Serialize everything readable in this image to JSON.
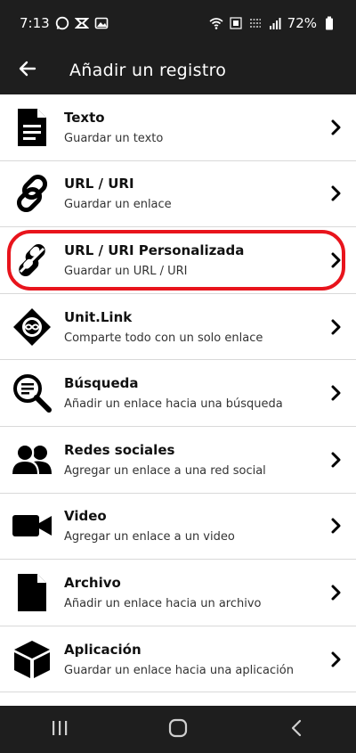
{
  "status_bar": {
    "time": "7:13",
    "battery_percent": "72%"
  },
  "app_bar": {
    "title": "Añadir un registro"
  },
  "items": [
    {
      "title": "Texto",
      "subtitle": "Guardar un texto",
      "icon": "document-icon"
    },
    {
      "title": "URL / URI",
      "subtitle": "Guardar un enlace",
      "icon": "link-icon"
    },
    {
      "title": "URL / URI Personalizada",
      "subtitle": "Guardar un URL / URI",
      "icon": "custom-link-icon",
      "highlighted": true
    },
    {
      "title": "Unit.Link",
      "subtitle": "Comparte todo con un solo enlace",
      "icon": "unitlink-logo-icon"
    },
    {
      "title": "Búsqueda",
      "subtitle": "Añadir un enlace hacia una búsqueda",
      "icon": "search-icon"
    },
    {
      "title": "Redes sociales",
      "subtitle": "Agregar un enlace a una red social",
      "icon": "people-icon"
    },
    {
      "title": "Video",
      "subtitle": "Agregar un enlace a un video",
      "icon": "video-camera-icon"
    },
    {
      "title": "Archivo",
      "subtitle": "Añadir un enlace hacia un archivo",
      "icon": "file-icon"
    },
    {
      "title": "Aplicación",
      "subtitle": "Guardar un enlace hacia una aplicación",
      "icon": "cube-icon"
    }
  ],
  "colors": {
    "bar_background": "#1e1e1e",
    "highlight": "#e8141c",
    "divider": "#d9d9d9"
  }
}
